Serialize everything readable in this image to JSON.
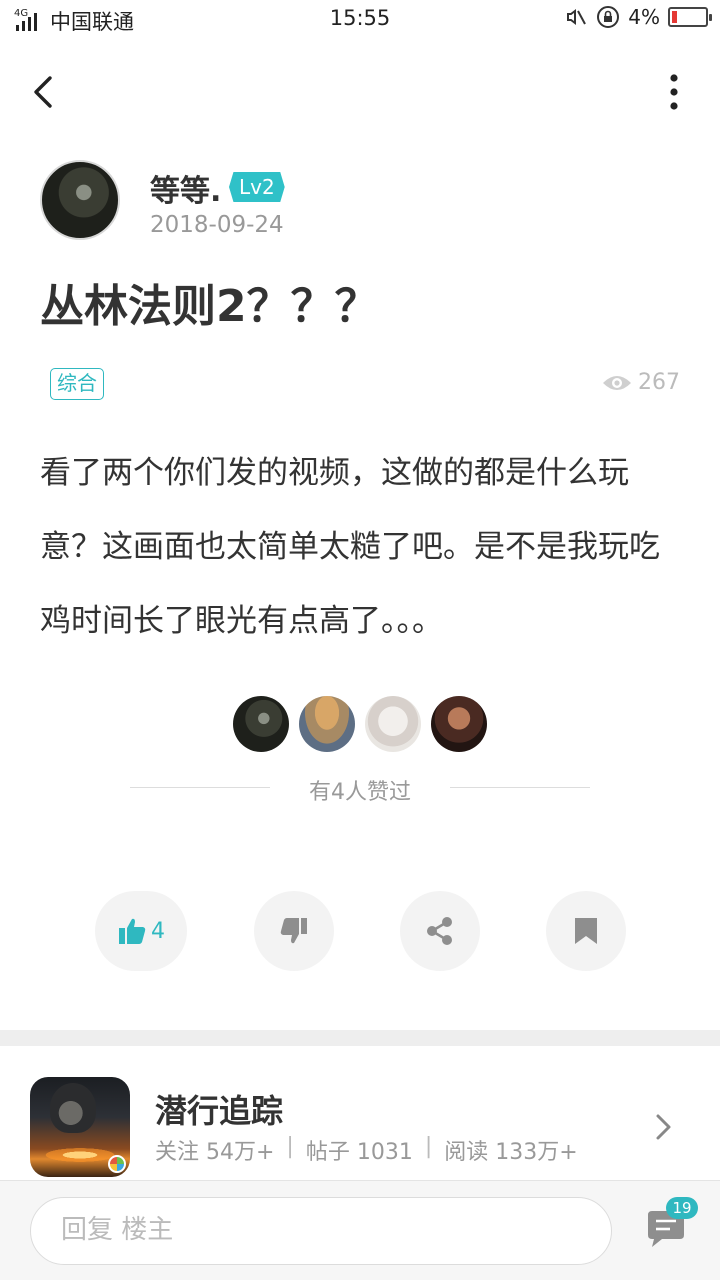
{
  "status_bar": {
    "network": "4G",
    "carrier": "中国联通",
    "time": "15:55",
    "battery_text": "4%"
  },
  "author": {
    "name": "等等.",
    "level": "Lv2",
    "date": "2018-09-24"
  },
  "post": {
    "title": "丛林法则2？？？",
    "category": "综合",
    "views": "267",
    "body": "看了两个你们发的视频，这做的都是什么玩意？这画面也太简单太糙了吧。是不是我玩吃鸡时间长了眼光有点高了。。。"
  },
  "likes": {
    "summary": "有4人赞过"
  },
  "actions": {
    "like_count": "4"
  },
  "game": {
    "name": "潜行追踪",
    "follow": "关注 54万+",
    "posts": "帖子 1031",
    "reads": "阅读 133万+"
  },
  "bottom": {
    "reply_placeholder": "回复  楼主",
    "comment_count": "19"
  },
  "colors": {
    "accent": "#2fb8c0",
    "badge": "#2fc1c8",
    "battery_low": "#e53935"
  }
}
